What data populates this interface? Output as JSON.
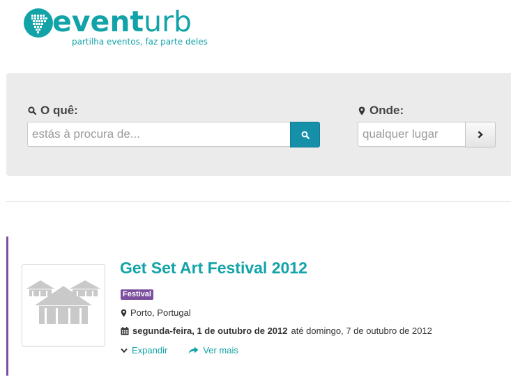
{
  "header": {
    "logo_bold": "event",
    "logo_light": "urb",
    "tagline": "partilha eventos, faz parte deles"
  },
  "search": {
    "what_label": "O quê:",
    "what_placeholder": "estás à procura de...",
    "where_label": "Onde:",
    "where_placeholder": "qualquer lugar"
  },
  "event": {
    "title": "Get Set Art Festival 2012",
    "category": "Festival",
    "location": "Porto, Portugal",
    "date_start": "segunda-feira, 1 de outubro de 2012",
    "date_end": "até domingo, 7 de outubro de 2012",
    "expand_label": "Expandir",
    "more_label": "Ver mais"
  },
  "colors": {
    "brand": "#12a3a8",
    "search_button": "#1590a8",
    "category": "#7b4f9e"
  }
}
